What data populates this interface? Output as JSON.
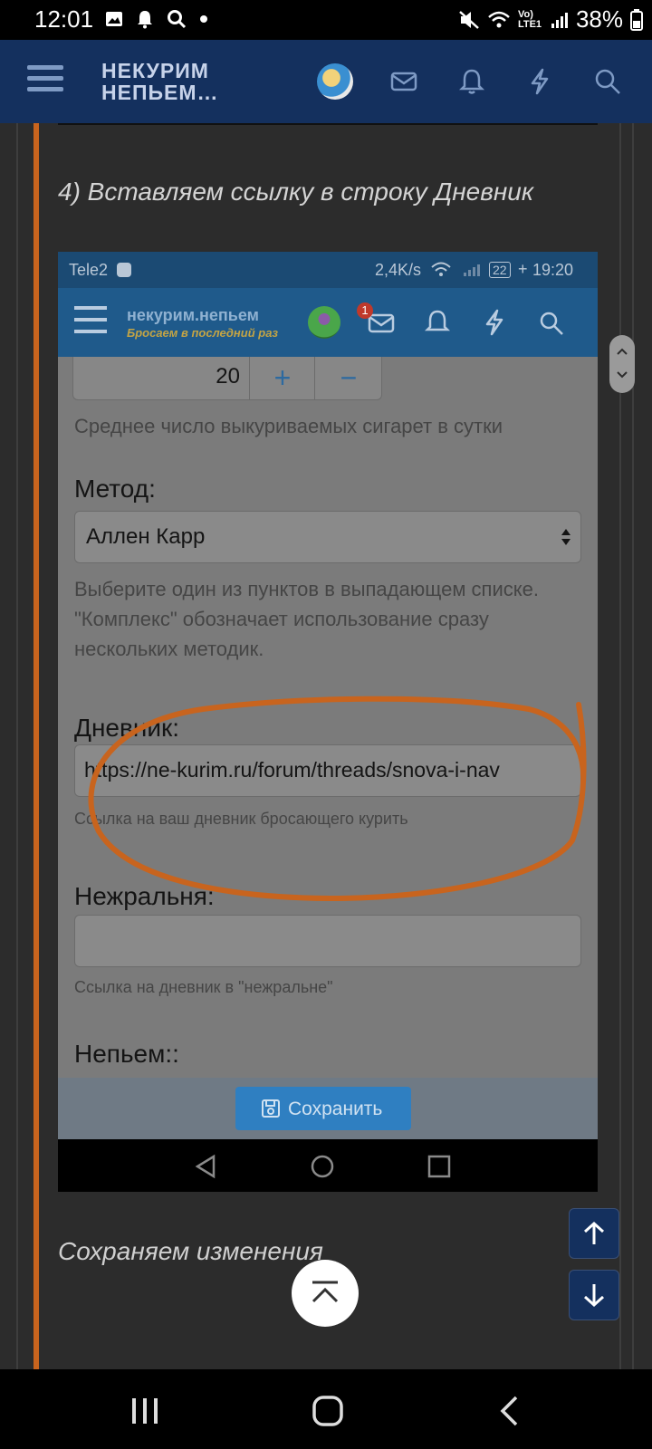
{
  "status_bar": {
    "time": "12:01",
    "battery": "38%",
    "network": "Vo) LTE1",
    "icons": [
      "image-icon",
      "bell-icon",
      "search-icon",
      "dot-icon",
      "mute-icon",
      "wifi-icon",
      "signal-icon",
      "battery-icon"
    ]
  },
  "header": {
    "logo_line1": "НЕКУРИМ",
    "logo_line2": "НЕПЬЕМ…",
    "icons": [
      "menu-icon",
      "avatar",
      "mail-icon",
      "bell-icon",
      "bolt-icon",
      "search-icon"
    ]
  },
  "post": {
    "step_text": "4) Вставляем ссылку в строку Дневник",
    "footer_text": "Сохраняем изменения"
  },
  "screenshot": {
    "status": {
      "carrier": "Tele2",
      "speed": "2,4K/s",
      "battery": "22",
      "time": "19:20"
    },
    "header": {
      "logo": "некурим.непьем",
      "tagline": "Бросаем в последний раз",
      "badge": "1"
    },
    "form": {
      "cigs_value": "20",
      "plus": "+",
      "minus": "−",
      "cigs_hint": "Среднее число выкуриваемых сигарет в сутки",
      "method_label": "Метод:",
      "method_value": "Аллен Карр",
      "method_hint": "Выберите один из пунктов в выпадающем списке. \"Комплекс\" обозначает использование сразу нескольких методик.",
      "diary_label": "Дневник:",
      "diary_value": "https://ne-kurim.ru/forum/threads/snova-i-nav",
      "diary_hint": "Ссылка на ваш дневник бросающего курить",
      "nezhral_label": "Нежральня:",
      "nezhral_value": "",
      "nezhral_hint": "Ссылка на дневник в \"нежральне\"",
      "nepem_label": "Непьем::"
    },
    "save_button": "Сохранить",
    "annotation_color": "#c8641e"
  },
  "colors": {
    "header_bg": "#14305e",
    "accent": "#c8641e",
    "page_bg": "#2c2c2c",
    "save_button": "#2f7fc1"
  }
}
